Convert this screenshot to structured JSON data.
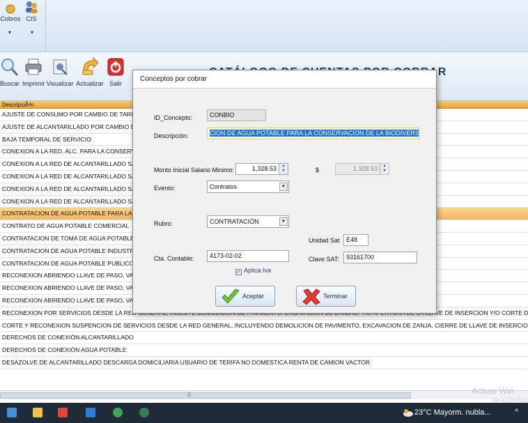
{
  "ribbon": {
    "cobros_label": "Cobros",
    "cis_label": "CIS",
    "drop_glyph": "▾"
  },
  "toolbar": {
    "buscar_label": "Buscar",
    "imprimir_label": "Imprimir",
    "visualizar_label": "Visualizar",
    "actualizar_label": "Actualizar",
    "salir_label": "Salir",
    "background_title": "CATÁLOGO DE CUENTAS POR COBRAR"
  },
  "grid": {
    "header": "DescripciÃ³n",
    "rows": [
      "AJUSTE DE CONSUMO  POR CAMBIO DE TARIFA",
      "AJUSTE DE ALCANTARILLADO POR CAMBIO DE TARIFA",
      "BAJA TEMPORAL DE SERVICIO",
      "CONEXION A LA RED. ALC. PARA LA CONSERVACION DE LA BIODIVERSIDAD",
      "CONEXION A LA RED DE ALCANTARILLADO SANITARIO",
      "CONEXION A LA RED DE ALCANTARILLADO SANITARIO",
      "CONEXION A LA RED DE ALCANTARILLADO SANITARIO",
      "CONEXION A LA RED DE ALCANTARILLADO SANITARIO",
      "CONTRATACION DE AGUA POTABLE PARA LA CONSERVACION DE LA BIODIVERSIDAD",
      "CONTRATO DE AGUA POTABLE COMERCIAL",
      "CONTRATACION DE TOMA DE AGUA POTABLE DOMESTICA",
      "CONTRATACION DE AGUA POTABLE INDUSTRIAL",
      "CONTRATACION DE AGUA POTABLE PUBLICO",
      "RECONEXION ABRIENDO LLAVE DE PASO, VALVULA LIMITADORA DE FLUJO O LLAVE DE BANQUETA",
      "RECONEXION ABRIENDO LLAVE DE PASO, VALVULA LIMITADORA DE FLUJO O LLAVE DE BANQUETA",
      "RECONEXION ABRIENDO LLAVE DE PASO, VALVULA LIMITADORA DE FLUJO O LLAVE DE BANQUETA REMOVIENDO PREVIO Y SELLO INDUSTRIAL",
      "RECONEXION POR SERVICIOS DESDE LA RED GENERAL, INCLUYE DEMOLICION DE PAVIMENTO, EXCAVACION DE ZANJAS, Y/O APERTURA DE LA LLAVE DE INSERCION Y/O CORTE DE TUBERIA",
      "CORTE Y RECONEXION  SUSPENCION DE SERVICIOS DESDE LA RED GENERAL, INCLUYENDO DEMOLICION DE PAVIMENTO, EXCAVACION DE ZANJA, CIERRE DE LLAVE DE INSERCION Y/O CORTE",
      "DERECHOS DE CONEXIÓN ALCANTARILLADO",
      "DERECHOS DE CONEXIÓN AGUA POTABLE",
      "DESAZOLVE DE ALCANTARILLADO DESCARGA DOMICILIARIA USUARIO DE TERIFA NO DOMESTICA RENTA DE CAMION VACTOR"
    ],
    "selected_index": 8,
    "scroll_grip": "|||"
  },
  "dialog": {
    "title": "Conceptos por cobrar",
    "id_label": "ID_Concepto:",
    "id_value": "CONBIO",
    "desc_label": "Descripción:",
    "desc_value": "CION DE AGUA POTABLE PARA LA CONSERVACION DE LA BIODIVERSIDAD",
    "monto_label": "Monto Inicial Salario Minimo:",
    "monto_value": "1,328.53",
    "currency_label": "$",
    "monto_pesos_value": "1,328.53",
    "evento_label": "Evento:",
    "evento_value": "Contratos",
    "rubro_label": "Rubro:",
    "rubro_value": "CONTRATACIÓN",
    "unidad_label": "Unidad Sat",
    "unidad_value": "E48",
    "cta_label": "Cta. Contable:",
    "cta_value": "4173-02-02",
    "clave_label": "Clave SAT:",
    "clave_value": "93161700",
    "aplica_iva_label": "Aplica Iva",
    "aplica_iva_checked": true,
    "aceptar_label": "Aceptar",
    "terminar_label": "Terminar"
  },
  "watermark": {
    "line1": "Activar Win",
    "line2": "Ve a Configura"
  },
  "taskbar": {
    "weather": "23°C  Mayorm. nubla...",
    "caret": "^"
  },
  "colors": {
    "selected_row": "#f4b45c",
    "header": "#e7a43c",
    "highlight": "#1c6fd3"
  }
}
